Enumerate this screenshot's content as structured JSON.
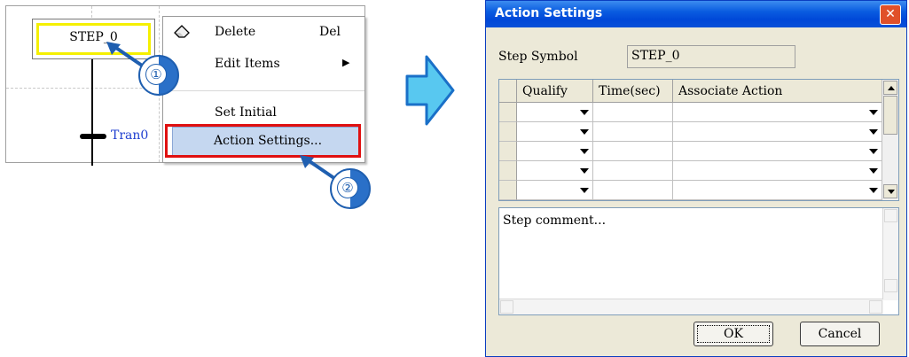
{
  "editor": {
    "step_label": "STEP_0",
    "transition_label": "Tran0"
  },
  "context_menu": {
    "items": [
      {
        "label": "Delete",
        "shortcut": "Del",
        "icon": "eraser-icon"
      },
      {
        "label": "Edit Items",
        "submenu": true
      },
      {
        "label": "Set Initial"
      },
      {
        "label": "Action Settings...",
        "highlighted": true
      }
    ]
  },
  "callouts": [
    "①",
    "②"
  ],
  "dialog": {
    "title": "Action Settings",
    "close_label": "✕",
    "step_symbol_label": "Step Symbol",
    "step_symbol_value": "STEP_0",
    "columns": [
      "Qualify",
      "Time(sec)",
      "Associate Action"
    ],
    "row_count": 5,
    "comment_placeholder": "Step comment...",
    "ok_label": "OK",
    "cancel_label": "Cancel"
  },
  "colors": {
    "titlebar": "#0a5ce0",
    "highlight_box": "#e01010",
    "callout_blue": "#2a70c8",
    "step_border": "#f5f000",
    "transition_text": "#1f3fd0"
  }
}
